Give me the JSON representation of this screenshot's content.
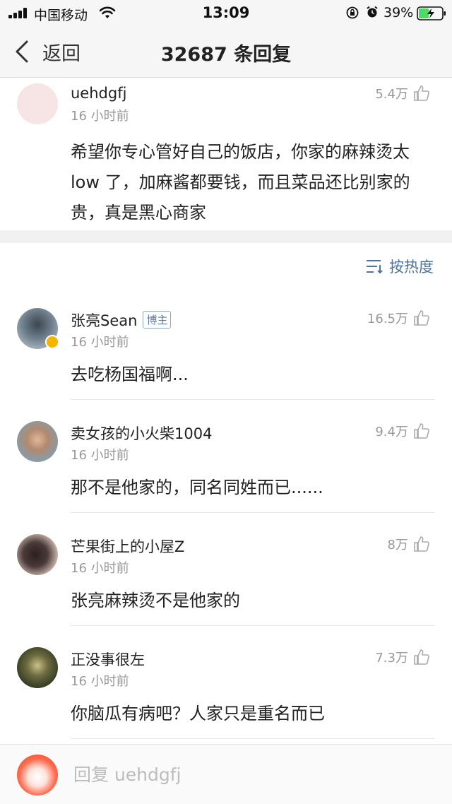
{
  "status_bar": {
    "carrier": "中国移动",
    "time": "13:09",
    "battery": "39%"
  },
  "nav": {
    "back_label": "返回",
    "title": "32687 条回复"
  },
  "original_comment": {
    "username": "uehdgfj",
    "time": "16 小时前",
    "likes": "5.4万",
    "text": "希望你专心管好自己的饭店，你家的麻辣烫太 low 了，加麻酱都要钱，而且菜品还比别家的贵，真是黑心商家"
  },
  "sort": {
    "label": "按热度"
  },
  "replies": [
    {
      "username": "张亮Sean",
      "badge": "博主",
      "time": "16 小时前",
      "likes": "16.5万",
      "text": "去吃杨国福啊..."
    },
    {
      "username": "卖女孩的小火柴1004",
      "time": "16 小时前",
      "likes": "9.4万",
      "text": "那不是他家的，同名同姓而已......"
    },
    {
      "username": "芒果街上的小屋Z",
      "time": "16 小时前",
      "likes": "8万",
      "text": "张亮麻辣烫不是他家的"
    },
    {
      "username": "正没事很左",
      "time": "16 小时前",
      "likes": "7.3万",
      "text": "你脑瓜有病吧？人家只是重名而已"
    }
  ],
  "reply_bar": {
    "placeholder": "回复 uehdgfj"
  },
  "icons": {
    "back": "chevron-left-icon",
    "like": "thumbs-up-icon",
    "sort": "sort-lines-icon",
    "verified": "verified-badge-icon"
  },
  "colors": {
    "accent_link": "#50739c",
    "secondary_text": "#999999",
    "verified": "#f4b400"
  }
}
